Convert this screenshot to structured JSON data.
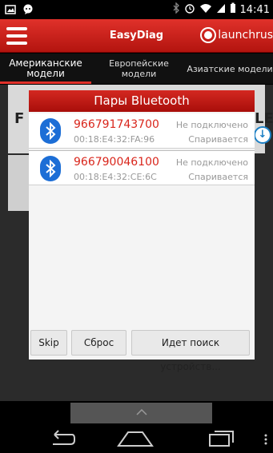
{
  "status_bar": {
    "time": "14:41",
    "icons": [
      "image-icon",
      "chat-icon",
      "bluetooth-icon",
      "alarm-icon",
      "wifi-icon",
      "signal-icon",
      "battery-icon"
    ]
  },
  "app_bar": {
    "title": "EasyDiag",
    "brand": "launchrus",
    "menu_icon": "menu-icon"
  },
  "tabs": [
    {
      "label": "Американские модели",
      "active": true
    },
    {
      "label": "Европейские модели",
      "active": false
    },
    {
      "label": "Азиатские модели",
      "active": false
    }
  ],
  "background": {
    "letter_left": "F",
    "letter_right": "LER"
  },
  "dialog": {
    "title": "Пары Bluetooth",
    "devices": [
      {
        "name": "966791743700",
        "mac": "00:18:E4:32:FA:96",
        "status": "Не подключено",
        "pairing": "Спаривается"
      },
      {
        "name": "966790046100",
        "mac": "00:18:E4:32:CE:6C",
        "status": "Не подключено",
        "pairing": "Спаривается"
      }
    ],
    "buttons": {
      "skip": "Skip",
      "reset": "Сброс",
      "search": "Идет поиск устройств..."
    }
  },
  "colors": {
    "accent": "#d42821",
    "bluetooth": "#1c6ed6"
  }
}
